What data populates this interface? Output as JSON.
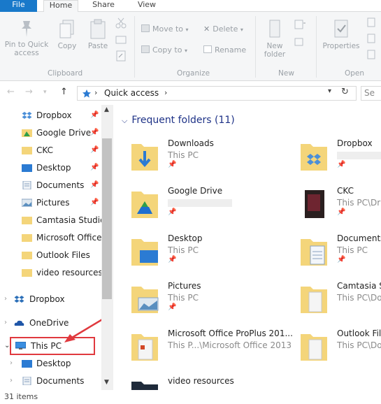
{
  "tabs": {
    "file": "File",
    "home": "Home",
    "share": "Share",
    "view": "View"
  },
  "ribbon": {
    "pin_quick_access": "Pin to Quick access",
    "copy": "Copy",
    "paste": "Paste",
    "move_to": "Move to",
    "copy_to": "Copy to",
    "delete": "Delete",
    "rename": "Rename",
    "new_folder": "New folder",
    "properties": "Properties",
    "groups": {
      "clipboard": "Clipboard",
      "organize": "Organize",
      "new": "New",
      "open": "Open"
    }
  },
  "address": {
    "location": "Quick access",
    "search_placeholder": "Se"
  },
  "nav_pane": {
    "quick_access_items": [
      {
        "label": "Dropbox",
        "icon": "dropbox-icon",
        "pinned": true
      },
      {
        "label": "Google Drive",
        "icon": "google-drive-icon",
        "pinned": true
      },
      {
        "label": "CKC",
        "icon": "folder-icon",
        "pinned": true
      },
      {
        "label": "Desktop",
        "icon": "desktop-icon",
        "pinned": true
      },
      {
        "label": "Documents",
        "icon": "documents-icon",
        "pinned": true
      },
      {
        "label": "Pictures",
        "icon": "pictures-icon",
        "pinned": true
      },
      {
        "label": "Camtasia Studio",
        "icon": "folder-icon",
        "pinned": false
      },
      {
        "label": "Microsoft Office",
        "icon": "folder-icon",
        "pinned": false
      },
      {
        "label": "Outlook Files",
        "icon": "folder-icon",
        "pinned": false
      },
      {
        "label": "video resources",
        "icon": "folder-icon",
        "pinned": false
      }
    ],
    "roots": [
      {
        "label": "Dropbox",
        "icon": "dropbox-icon"
      },
      {
        "label": "OneDrive",
        "icon": "onedrive-icon"
      },
      {
        "label": "This PC",
        "icon": "this-pc-icon"
      },
      {
        "label": "Desktop",
        "icon": "desktop-icon"
      },
      {
        "label": "Documents",
        "icon": "documents-icon"
      }
    ]
  },
  "content": {
    "header": "Frequent folders (11)",
    "folders": [
      {
        "name": "Downloads",
        "location": "This PC"
      },
      {
        "name": "Dropbox",
        "location": ""
      },
      {
        "name": "Google Drive",
        "location": ""
      },
      {
        "name": "CKC",
        "location": "This PC\\Dr"
      },
      {
        "name": "Desktop",
        "location": "This PC"
      },
      {
        "name": "Documents",
        "location": "This PC"
      },
      {
        "name": "Pictures",
        "location": "This PC"
      },
      {
        "name": "Camtasia St",
        "location": "This PC\\Do"
      },
      {
        "name": "Microsoft Office ProPlus 201...",
        "location": "This P...\\Microsoft Office 2013"
      },
      {
        "name": "Outlook File",
        "location": "This PC\\Do"
      },
      {
        "name": "video resources",
        "location": ""
      }
    ]
  },
  "status": {
    "items": "31 items"
  },
  "colors": {
    "accent": "#1979ca",
    "annotation_red": "#e0393e",
    "folder": "#f4d57a",
    "header_blue": "#1e3287"
  }
}
